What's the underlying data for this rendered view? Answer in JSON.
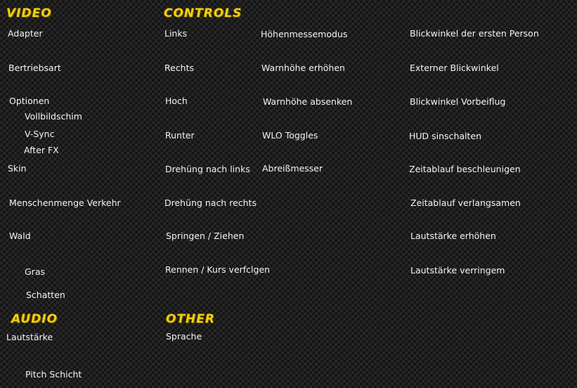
{
  "theme": {
    "header_color": "#f2cf0e",
    "text_color": "#f4f4f4",
    "background": "carbon-fiber"
  },
  "video": {
    "title": "VIDEO",
    "adapter": "Adapter",
    "mode": "Bertriebsart",
    "options": "Optionen",
    "fullscreen": "Vollbildschim",
    "vsync": "V-Sync",
    "afterfx": "After FX",
    "skin": "Skin",
    "crowd_traffic": "Menschenmenge Verkehr",
    "forest": "Wald",
    "grass": "Gras",
    "shadows": "Schatten"
  },
  "audio": {
    "title": "AUDIO",
    "volume": "Lautstärke",
    "pitch_layer": "Pitch Schicht"
  },
  "controls": {
    "title": "CONTROLS",
    "col1": [
      "Links",
      "Rechts",
      "Hoch",
      "Runter",
      "Drehüng nach links",
      "Drehüng nach rechts",
      "Springen / Ziehen",
      "Rennen / Kurs verfclgen"
    ],
    "col2": [
      "Höhenmessemodus",
      "Warnhöhe erhöhen",
      "Warnhöhe absenken",
      "WLO Toggles",
      "Abreißmesser"
    ],
    "col3": [
      "Blickwinkel der ersten Person",
      "Externer Blickwinkel",
      "Blickwinkel Vorbeiflug",
      "HUD sinschalten",
      "Zeitablauf beschleunigen",
      "Zeitablauf verlangsamen",
      "Lautstärke erhöhen",
      "Lautstärke verringem"
    ]
  },
  "other": {
    "title": "OTHER",
    "language": "Sprache"
  }
}
